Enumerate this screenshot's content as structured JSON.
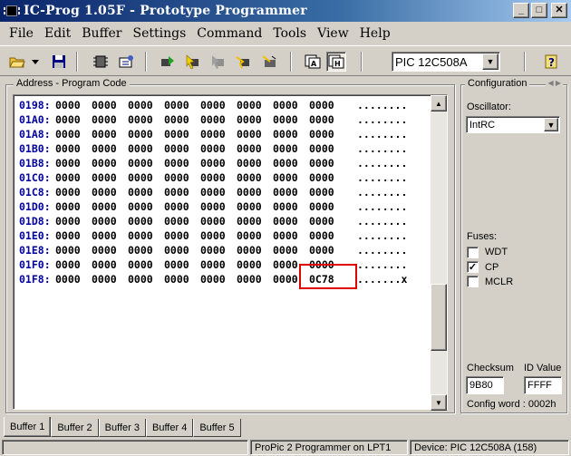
{
  "window": {
    "title": "IC-Prog 1.05F - Prototype Programmer",
    "minimize": "_",
    "maximize": "□",
    "close": "✕"
  },
  "menu": [
    "File",
    "Edit",
    "Buffer",
    "Settings",
    "Command",
    "Tools",
    "View",
    "Help"
  ],
  "toolbar": {
    "device": "PIC 12C508A",
    "icons": [
      "open-file-icon",
      "dropdown-arrow-icon",
      "save-icon",
      "chip-read-icon",
      "chip-config-icon",
      "read-device-icon",
      "program-device-icon",
      "erase-device-icon",
      "verify-device-icon",
      "blank-check-icon",
      "assembler-view-icon",
      "hex-view-icon",
      "help-icon"
    ]
  },
  "program_code": {
    "label": "Address - Program Code",
    "rows": [
      {
        "addr": "0198:",
        "words": [
          "0000",
          "0000",
          "0000",
          "0000",
          "0000",
          "0000",
          "0000",
          "0000"
        ],
        "ascii": "........"
      },
      {
        "addr": "01A0:",
        "words": [
          "0000",
          "0000",
          "0000",
          "0000",
          "0000",
          "0000",
          "0000",
          "0000"
        ],
        "ascii": "........"
      },
      {
        "addr": "01A8:",
        "words": [
          "0000",
          "0000",
          "0000",
          "0000",
          "0000",
          "0000",
          "0000",
          "0000"
        ],
        "ascii": "........"
      },
      {
        "addr": "01B0:",
        "words": [
          "0000",
          "0000",
          "0000",
          "0000",
          "0000",
          "0000",
          "0000",
          "0000"
        ],
        "ascii": "........"
      },
      {
        "addr": "01B8:",
        "words": [
          "0000",
          "0000",
          "0000",
          "0000",
          "0000",
          "0000",
          "0000",
          "0000"
        ],
        "ascii": "........"
      },
      {
        "addr": "01C0:",
        "words": [
          "0000",
          "0000",
          "0000",
          "0000",
          "0000",
          "0000",
          "0000",
          "0000"
        ],
        "ascii": "........"
      },
      {
        "addr": "01C8:",
        "words": [
          "0000",
          "0000",
          "0000",
          "0000",
          "0000",
          "0000",
          "0000",
          "0000"
        ],
        "ascii": "........"
      },
      {
        "addr": "01D0:",
        "words": [
          "0000",
          "0000",
          "0000",
          "0000",
          "0000",
          "0000",
          "0000",
          "0000"
        ],
        "ascii": "........"
      },
      {
        "addr": "01D8:",
        "words": [
          "0000",
          "0000",
          "0000",
          "0000",
          "0000",
          "0000",
          "0000",
          "0000"
        ],
        "ascii": "........"
      },
      {
        "addr": "01E0:",
        "words": [
          "0000",
          "0000",
          "0000",
          "0000",
          "0000",
          "0000",
          "0000",
          "0000"
        ],
        "ascii": "........"
      },
      {
        "addr": "01E8:",
        "words": [
          "0000",
          "0000",
          "0000",
          "0000",
          "0000",
          "0000",
          "0000",
          "0000"
        ],
        "ascii": "........"
      },
      {
        "addr": "01F0:",
        "words": [
          "0000",
          "0000",
          "0000",
          "0000",
          "0000",
          "0000",
          "0000",
          "0000"
        ],
        "ascii": "........"
      },
      {
        "addr": "01F8:",
        "words": [
          "0000",
          "0000",
          "0000",
          "0000",
          "0000",
          "0000",
          "0000",
          "0C78"
        ],
        "ascii": ".......x"
      }
    ],
    "highlight_color": "#e00000"
  },
  "configuration": {
    "label": "Configuration",
    "oscillator_label": "Oscillator:",
    "oscillator_value": "IntRC",
    "fuses_label": "Fuses:",
    "fuses": [
      {
        "name": "WDT",
        "checked": false
      },
      {
        "name": "CP",
        "checked": true
      },
      {
        "name": "MCLR",
        "checked": false
      }
    ],
    "checksum_label": "Checksum",
    "checksum_value": "9B80",
    "id_label": "ID Value",
    "id_value": "FFFF",
    "config_word": "Config word : 0002h"
  },
  "tabs": [
    "Buffer 1",
    "Buffer 2",
    "Buffer 3",
    "Buffer 4",
    "Buffer 5"
  ],
  "active_tab": "Buffer 1",
  "status": {
    "programmer": "ProPic 2 Programmer on LPT1",
    "device": "Device: PIC 12C508A  (158)"
  }
}
